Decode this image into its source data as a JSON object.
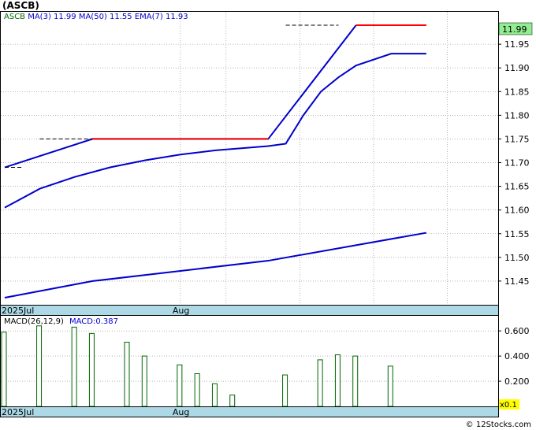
{
  "title": "(ASCB)",
  "footer": "© 12Stocks.com",
  "colors": {
    "price_up": "#ff0000",
    "ma": "#0000cc",
    "macd_bar": "#006600",
    "date_band": "#add8e6",
    "last_price_box": "#90ee90",
    "scale_box": "#ffff00",
    "grid": "#888888"
  },
  "chart_data": [
    {
      "type": "line",
      "name": "price",
      "legend": [
        {
          "label": "ASCB",
          "color": "#006600"
        },
        {
          "label": "MA(3)",
          "color": "#0000cc"
        },
        {
          "label": "11.99",
          "color": "#0000cc"
        },
        {
          "label": "MA(50)",
          "color": "#0000cc"
        },
        {
          "label": "11.55",
          "color": "#0000cc"
        },
        {
          "label": "EMA(7)",
          "color": "#0000cc"
        },
        {
          "label": "11.93",
          "color": "#0000cc"
        }
      ],
      "ylim": [
        11.4,
        12.02
      ],
      "yticks": [
        "11.99",
        "11.95",
        "11.90",
        "11.85",
        "11.80",
        "11.75",
        "11.70",
        "11.65",
        "11.60",
        "11.55",
        "11.50",
        "11.45"
      ],
      "last_price": "11.99",
      "xticks": [
        {
          "label": "2025Jul",
          "x": 0
        },
        {
          "label": "Aug",
          "x": 10
        }
      ],
      "xlim": [
        0,
        28
      ],
      "grid": true,
      "price_segments": [
        {
          "x": [
            0,
            1
          ],
          "y": [
            11.69,
            11.69
          ],
          "style": "dash"
        },
        {
          "x": [
            2,
            5
          ],
          "y": [
            11.75,
            11.75
          ],
          "style": "dash"
        },
        {
          "x": [
            5,
            15
          ],
          "y": [
            11.75,
            11.75
          ],
          "style": "solid"
        },
        {
          "x": [
            16,
            19
          ],
          "y": [
            11.99,
            11.99
          ],
          "style": "dash"
        },
        {
          "x": [
            20,
            24
          ],
          "y": [
            11.99,
            11.99
          ],
          "style": "solid"
        }
      ],
      "series": [
        {
          "name": "MA(3)",
          "x": [
            0,
            5,
            15,
            20
          ],
          "y": [
            11.69,
            11.75,
            11.75,
            11.99
          ]
        },
        {
          "name": "EMA(7)",
          "x": [
            0,
            2,
            4,
            6,
            8,
            10,
            12,
            15,
            16,
            17,
            18,
            19,
            20,
            22,
            24
          ],
          "y": [
            11.605,
            11.645,
            11.67,
            11.69,
            11.705,
            11.717,
            11.726,
            11.735,
            11.74,
            11.8,
            11.85,
            11.88,
            11.905,
            11.93,
            11.93
          ]
        },
        {
          "name": "MA(50)",
          "x": [
            0,
            5,
            15,
            24
          ],
          "y": [
            11.415,
            11.45,
            11.493,
            11.552
          ]
        }
      ]
    },
    {
      "type": "bar",
      "name": "macd",
      "label": "MACD(26,12,9)",
      "value_label": "MACD:0.387",
      "ylim": [
        0.0,
        0.72
      ],
      "yticks": [
        "0.600",
        "0.400",
        "0.200"
      ],
      "xticks": [
        {
          "label": "2025Jul",
          "x": 0
        },
        {
          "label": "Aug",
          "x": 10
        }
      ],
      "xlim": [
        0,
        28
      ],
      "scale_label": "x0.1",
      "bars": [
        {
          "x": 0,
          "value": 0.59
        },
        {
          "x": 2,
          "value": 0.64
        },
        {
          "x": 4,
          "value": 0.63
        },
        {
          "x": 5,
          "value": 0.58
        },
        {
          "x": 7,
          "value": 0.51
        },
        {
          "x": 8,
          "value": 0.4
        },
        {
          "x": 10,
          "value": 0.33
        },
        {
          "x": 11,
          "value": 0.26
        },
        {
          "x": 12,
          "value": 0.18
        },
        {
          "x": 13,
          "value": 0.09
        },
        {
          "x": 16,
          "value": 0.25
        },
        {
          "x": 18,
          "value": 0.37
        },
        {
          "x": 19,
          "value": 0.41
        },
        {
          "x": 20,
          "value": 0.4
        },
        {
          "x": 22,
          "value": 0.32
        }
      ]
    }
  ]
}
